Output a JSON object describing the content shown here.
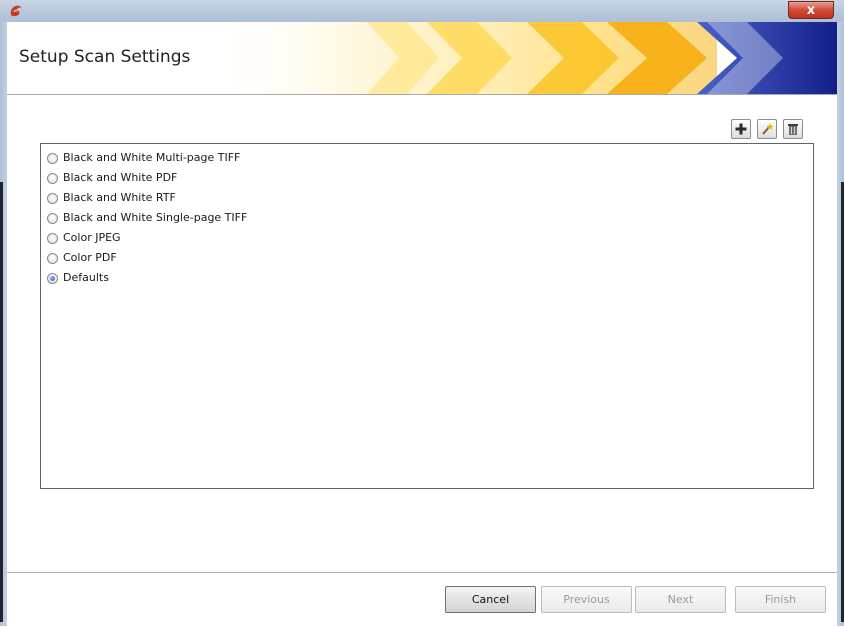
{
  "window": {
    "close_label": "x",
    "close_color": "#c0321f"
  },
  "header": {
    "title": "Setup Scan Settings",
    "accent_colors": [
      "#ffd64a",
      "#f7b21c",
      "#1f2d9a"
    ]
  },
  "toolbar": {
    "buttons": [
      {
        "icon": "plus-icon"
      },
      {
        "icon": "magic-wand-icon"
      },
      {
        "icon": "delete-icon"
      }
    ]
  },
  "scan_settings": {
    "selected": "Defaults",
    "options": [
      {
        "label": "Black and White Multi-page TIFF",
        "checked": false
      },
      {
        "label": "Black and White PDF",
        "checked": false
      },
      {
        "label": "Black and White RTF",
        "checked": false
      },
      {
        "label": "Black and White Single-page TIFF",
        "checked": false
      },
      {
        "label": "Color JPEG",
        "checked": false
      },
      {
        "label": "Color PDF",
        "checked": false
      },
      {
        "label": "Defaults",
        "checked": true
      }
    ]
  },
  "footer": {
    "cancel_label": "Cancel",
    "previous_label": "Previous",
    "next_label": "Next",
    "finish_label": "Finish"
  }
}
